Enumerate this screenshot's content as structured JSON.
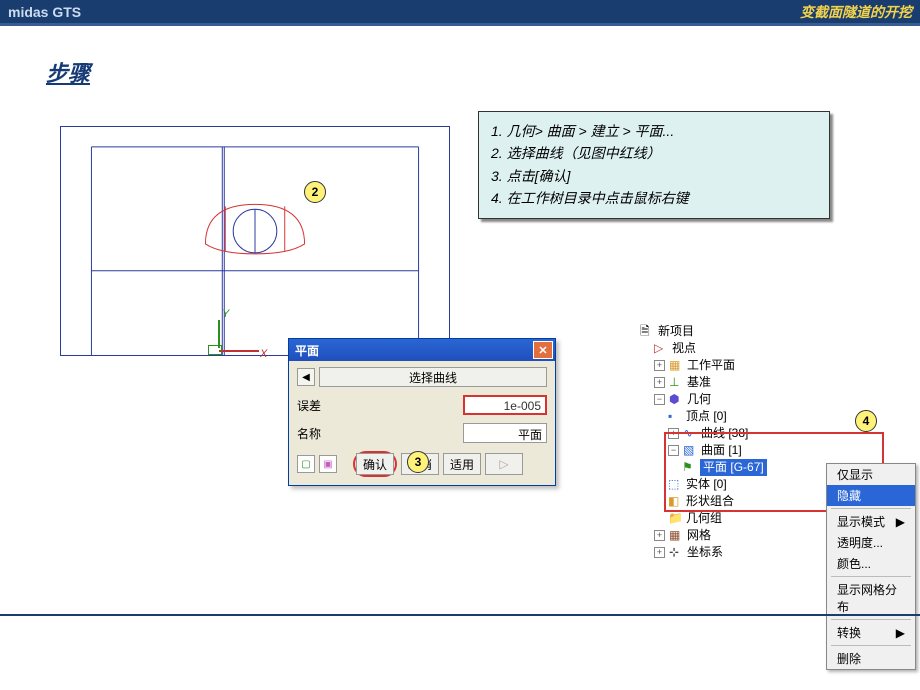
{
  "titlebar": {
    "left": "midas GTS",
    "right": "变截面隧道的开挖"
  },
  "heading": "步骤",
  "callouts": {
    "c2": "2",
    "c3": "3",
    "c4": "4"
  },
  "axes": {
    "x": "X",
    "y": "Y"
  },
  "instructions": {
    "l1": "1. 几何> 曲面 > 建立 > 平面...",
    "l2": "2. 选择曲线（见图中红线）",
    "l3": "3. 点击[确认]",
    "l4": "4. 在工作树目录中点击鼠标右键"
  },
  "dialog": {
    "title": "平面",
    "select_label": "选择曲线",
    "tol_label": "误差",
    "tol_value": "1e-005",
    "name_label": "名称",
    "name_value": "平面",
    "arrow": "◀",
    "ok": "确认",
    "cancel": "取消",
    "apply": "适用",
    "next": "▷",
    "close_x": "✕",
    "icon_g": "▢",
    "icon_p": "▣"
  },
  "tree": {
    "new_project": "新项目",
    "viewpoint": "视点",
    "workplane": "工作平面",
    "datum": "基准",
    "geometry": "几何",
    "vertex": "顶点 [0]",
    "curve": "曲线 [38]",
    "surface": "曲面 [1]",
    "plane": "平面",
    "plane_id": "[G-67]",
    "solid": "实体 [0]",
    "shapes": "形状组合",
    "geogroup": "几何组",
    "mesh": "网格",
    "coord": "坐标系",
    "plus": "+",
    "minus": "−",
    "i_doc": "🗎",
    "i_view": "▷",
    "i_grid": "▦",
    "i_axis": "⊥",
    "i_geo": "⬢",
    "i_pt": "▪",
    "i_wave": "∿",
    "i_surf": "▧",
    "i_flag": "⚑",
    "i_cube": "⬚",
    "i_shapes": "◧",
    "i_fold": "📁",
    "i_mesh": "▦",
    "i_coord": "⊹"
  },
  "contextmenu": {
    "only_show": "仅显示",
    "hide": "隐藏",
    "disp_mode": "显示模式",
    "transparency": "透明度...",
    "color": "颜色...",
    "show_mesh": "显示网格分布",
    "transform": "转换",
    "delete": "删除",
    "arrow": "▶"
  }
}
